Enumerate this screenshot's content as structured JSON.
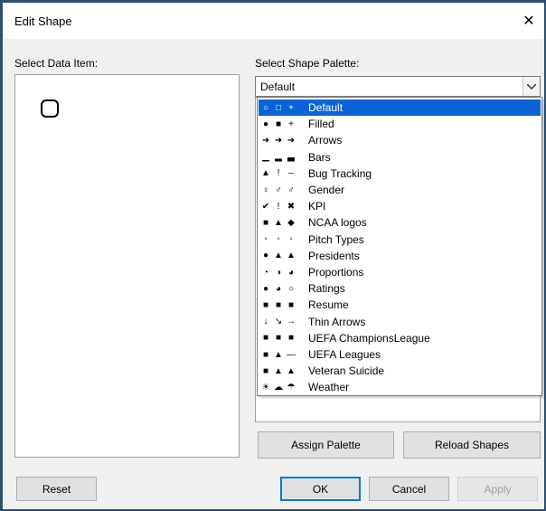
{
  "window": {
    "title": "Edit Shape",
    "close_icon": "close-icon"
  },
  "labels": {
    "data_item": "Select Data Item:",
    "palette": "Select Shape Palette:"
  },
  "palette_combo": {
    "value": "Default"
  },
  "palettes": [
    {
      "label": "Default",
      "icons": [
        "○",
        "□",
        "+"
      ],
      "selected": true
    },
    {
      "label": "Filled",
      "icons": [
        "●",
        "■",
        "+"
      ]
    },
    {
      "label": "Arrows",
      "icons": [
        "➜",
        "➜",
        "➜"
      ]
    },
    {
      "label": "Bars",
      "icons": [
        "▁",
        "▂",
        "▃"
      ]
    },
    {
      "label": "Bug Tracking",
      "icons": [
        "▲",
        "!",
        "–"
      ]
    },
    {
      "label": "Gender",
      "icons": [
        "♀",
        "♂",
        "♂"
      ]
    },
    {
      "label": "KPI",
      "icons": [
        "✔",
        "!",
        "✖"
      ]
    },
    {
      "label": "NCAA logos",
      "icons": [
        "■",
        "▲",
        "◆"
      ]
    },
    {
      "label": "Pitch Types",
      "icons": [
        "◦",
        "◦",
        "◦"
      ]
    },
    {
      "label": "Presidents",
      "icons": [
        "●",
        "▲",
        "▲"
      ]
    },
    {
      "label": "Proportions",
      "icons": [
        "◔",
        "◑",
        "◕"
      ]
    },
    {
      "label": "Ratings",
      "icons": [
        "●",
        "◕",
        "○"
      ]
    },
    {
      "label": "Resume",
      "icons": [
        "■",
        "■",
        "■"
      ]
    },
    {
      "label": "Thin Arrows",
      "icons": [
        "↓",
        "↘",
        "→"
      ]
    },
    {
      "label": "UEFA ChampionsLeague",
      "icons": [
        "■",
        "■",
        "■"
      ]
    },
    {
      "label": "UEFA Leagues",
      "icons": [
        "■",
        "▲",
        "—"
      ]
    },
    {
      "label": "Veteran Suicide",
      "icons": [
        "■",
        "▲",
        "▲"
      ]
    },
    {
      "label": "Weather",
      "icons": [
        "☀",
        "☁",
        "☂"
      ]
    }
  ],
  "buttons": {
    "assign": "Assign Palette",
    "reload": "Reload Shapes",
    "reset": "Reset",
    "ok": "OK",
    "cancel": "Cancel",
    "apply": "Apply"
  },
  "colors": {
    "selection": "#0a64d8",
    "default_border": "#0078d7"
  }
}
